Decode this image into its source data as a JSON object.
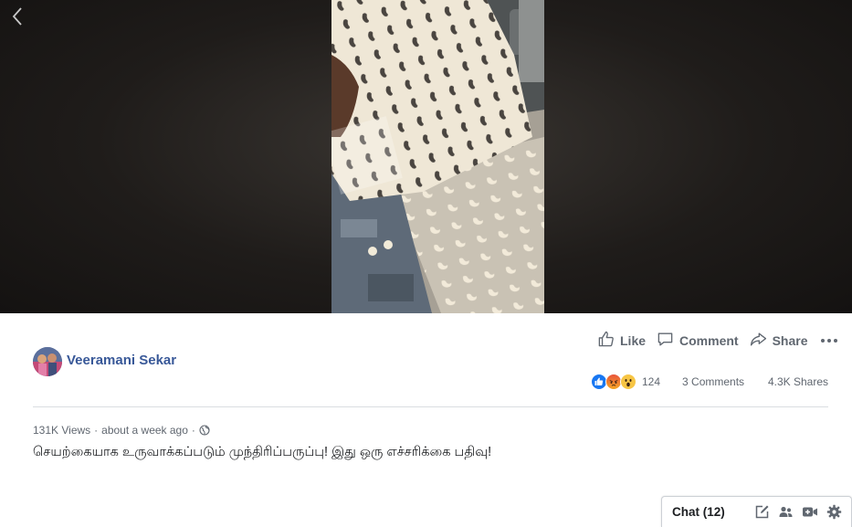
{
  "video": {
    "back_icon": "chevron-left-icon"
  },
  "post": {
    "author": "Veeramani Sekar",
    "views": "131K Views",
    "time": "about a week ago",
    "privacy_icon": "globe-icon",
    "caption": "செயற்கையாக உருவாக்கப்படும் முந்திரிப்பருப்பு! இது ஒரு எச்சரிக்கை பதிவு!"
  },
  "actions": {
    "like": "Like",
    "comment": "Comment",
    "share": "Share",
    "more_icon": "more-options-icon"
  },
  "stats": {
    "reaction_icons": [
      "like-icon",
      "angry-icon",
      "wow-icon"
    ],
    "reaction_count": "124",
    "comments": "3 Comments",
    "shares": "4.3K Shares"
  },
  "chat": {
    "label": "Chat (12)",
    "icons": [
      "new-message-icon",
      "create-group-icon",
      "video-call-icon",
      "settings-icon"
    ]
  },
  "colors": {
    "link": "#385898",
    "like_blue": "#1877f2",
    "text_secondary": "#606770"
  }
}
